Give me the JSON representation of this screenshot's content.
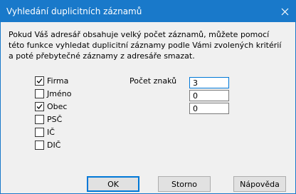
{
  "window": {
    "title": "Vyhledání duplicitních záznamů"
  },
  "description": "Pokud Váš adresář obsahuje velký počet záznamů, můžete pomocí této funkce vyhledat duplicitní záznamy podle Vámi zvolených kritérií a poté přebytečné záznamy z adresáře smazat.",
  "criteria": [
    {
      "label": "Firma",
      "checked": true
    },
    {
      "label": "Jméno",
      "checked": false
    },
    {
      "label": "Obec",
      "checked": true
    },
    {
      "label": "PSČ",
      "checked": false
    },
    {
      "label": "IČ",
      "checked": false
    },
    {
      "label": "DIČ",
      "checked": false
    }
  ],
  "char_count": {
    "label": "Počet znaků",
    "values": [
      "3",
      "0",
      "0"
    ]
  },
  "buttons": {
    "ok": "OK",
    "cancel": "Storno",
    "help": "Nápověda"
  }
}
